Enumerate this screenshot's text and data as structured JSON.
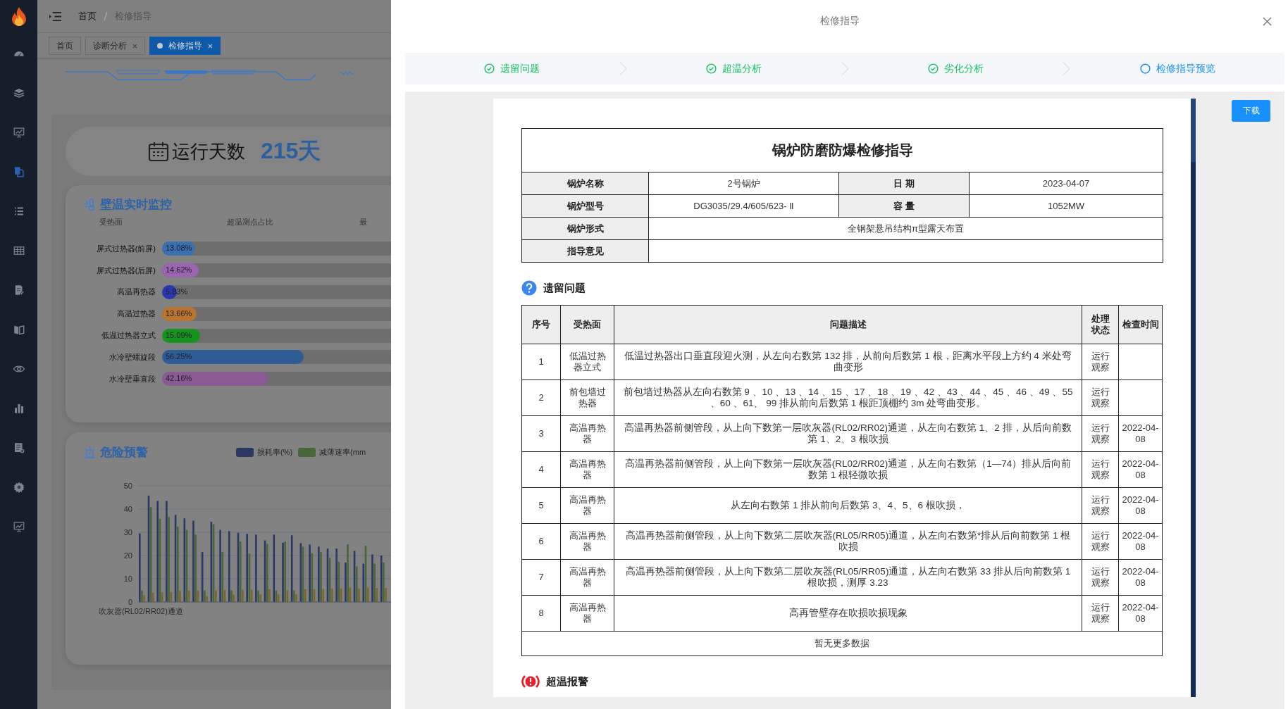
{
  "sidebar": {
    "items": [
      {
        "selected": false
      },
      {
        "selected": false
      },
      {
        "selected": false
      },
      {
        "selected": true
      },
      {
        "selected": false
      },
      {
        "selected": false
      },
      {
        "selected": false
      },
      {
        "selected": false
      },
      {
        "selected": false
      },
      {
        "selected": false
      },
      {
        "selected": false
      },
      {
        "selected": false
      },
      {
        "selected": false
      }
    ]
  },
  "breadcrumb": [
    "首页",
    "检修指导"
  ],
  "tags": [
    {
      "label": "首页",
      "selected": false,
      "closable": false
    },
    {
      "label": "诊断分析",
      "selected": false,
      "closable": true
    },
    {
      "label": "检修指导",
      "selected": true,
      "closable": true
    }
  ],
  "run_days": {
    "label": "运行天数",
    "value": "215天"
  },
  "wall_temp": {
    "title": "壁温实时监控",
    "columns": [
      "受热面",
      "超温测点占比",
      "最"
    ],
    "rows": [
      {
        "name": "屏式过热器(前屏)",
        "level": 0.1308,
        "reading": "13.08%",
        "color": "#3a6fb0"
      },
      {
        "name": "屏式过热器(后屏)",
        "level": 0.1462,
        "reading": "14.62%",
        "color": "#9a64ae"
      },
      {
        "name": "高温再热器",
        "level": 0.0583,
        "reading": "5.83%",
        "color": "#2a38b0"
      },
      {
        "name": "高温过热器",
        "level": 0.1366,
        "reading": "13.66%",
        "color": "#b97530"
      },
      {
        "name": "低温过热器立式",
        "level": 0.1509,
        "reading": "15.09%",
        "color": "#16951e"
      },
      {
        "name": "水冷壁螺旋段",
        "level": 0.5625,
        "reading": "56.25%",
        "color": "#2e5d95"
      },
      {
        "name": "水冷壁垂直段",
        "level": 0.4216,
        "reading": "42.16%",
        "color": "#8a5a92"
      }
    ]
  },
  "danger": {
    "title": "危险预警",
    "chart_data": {
      "type": "bar",
      "grid": true,
      "ylim": [
        0,
        50
      ],
      "yticks": [
        0,
        10,
        20,
        30,
        40,
        50
      ],
      "categories": [
        "吹灰器(RL02/RR02)通道",
        null,
        null,
        null,
        null,
        null,
        null,
        null,
        null,
        null,
        null,
        null,
        null,
        null,
        null,
        null,
        null,
        null,
        null,
        null,
        null,
        null,
        null,
        null,
        null,
        null,
        null,
        null
      ],
      "series": [
        {
          "name": "损耗率(%)",
          "color": "#2a3863",
          "values": [
            29.5,
            45.8,
            43.5,
            43.5,
            37.5,
            36,
            35,
            21.5,
            34.5,
            31,
            30.5,
            29.8,
            29.3,
            29,
            26.5,
            29,
            25.5,
            28.7,
            25.3,
            24.7,
            23.8,
            23,
            23,
            17,
            22,
            16.5,
            20.5,
            20
          ]
        },
        {
          "name": "减薄速率(mm",
          "color": "#48663a",
          "values": [
            5,
            40.8,
            35.8,
            36.7,
            32.5,
            31,
            29,
            5,
            33.5,
            21.5,
            5,
            26,
            20.8,
            5,
            25,
            5,
            26,
            5,
            23.8,
            21,
            21.5,
            19,
            17.3,
            24.8,
            15.3,
            24.2,
            16.5,
            17
          ]
        },
        {
          "color": "#7d642c",
          "values": [
            3,
            4,
            4.2,
            4.3,
            4.8,
            4.9,
            5,
            2.5,
            5,
            5.2,
            3.2,
            5.3,
            5.3,
            3.2,
            5.5,
            3.2,
            5,
            3.2,
            5.5,
            5.5,
            5.6,
            5.8,
            5.8,
            6.2,
            5.8,
            6.2,
            6,
            6
          ]
        }
      ]
    }
  },
  "drawer": {
    "title": "检修指导",
    "steps": [
      {
        "label": "遗留问题",
        "completed": true
      },
      {
        "label": "超温分析",
        "completed": true
      },
      {
        "label": "劣化分析",
        "completed": true
      },
      {
        "label": "检修指导预览",
        "completed": false
      }
    ],
    "download": "下载",
    "document": {
      "title": "锅炉防磨防爆检修指导",
      "info_rows": [
        [
          {
            "label": "锅炉名称",
            "value": "2号锅炉"
          },
          {
            "label": "日 期",
            "value": "2023-04-07"
          }
        ],
        [
          {
            "label": "锅炉型号",
            "value": "DG3035/29.4/605/623- Ⅱ"
          },
          {
            "label": "容 量",
            "value": "1052MW"
          }
        ],
        [
          {
            "label": "锅炉形式",
            "value": "全钢架悬吊结构π型露天布置"
          }
        ],
        [
          {
            "label": "指导意见"
          }
        ]
      ],
      "sections": [
        {
          "kind": "question",
          "title": "遗留问题",
          "table": {
            "columns": [
              "序号",
              "受热面",
              "问题描述",
              "处理状态",
              "检查时间"
            ],
            "rows": [
              {
                "no": "1",
                "surface": "低温过热器立式",
                "description": "低温过热器出口垂直段迎火测，从左向右数第 132 排，从前向后数第 1 根，距离水平段上方约 4 米处弯曲变形",
                "status": "运行观察"
              },
              {
                "no": "2",
                "surface": "前包墙过热器",
                "description": "前包墙过热器从左向右数第 9 、10 、13 、14 、15 、17 、18 、19 、42 、43 、44 、45 、46 、49 、55 、60 、61、 99 排从前向后数第 1 根距顶棚约 3m 处弯曲变形。",
                "status": "运行观察"
              },
              {
                "no": "3",
                "surface": "高温再热器",
                "description": "高温再热器前侧管段，从上向下数第一层吹灰器(RL02/RR02)通道，从左向右数第 1、2 排，从后向前数第 1、2、3 根吹损",
                "status": "运行观察",
                "time": "2022-04-08"
              },
              {
                "no": "4",
                "surface": "高温再热器",
                "description": "高温再热器前侧管段，从上向下数第一层吹灰器(RL02/RR02)通道，从左向右数第（1—74）排从后向前数第 1 根轻微吹损",
                "status": "运行观察",
                "time": "2022-04-08"
              },
              {
                "no": "5",
                "surface": "高温再热器",
                "description": "从左向右数第 1 排从前向后数第 3、4、5、6 根吹损，",
                "status": "运行观察",
                "time": "2022-04-08"
              },
              {
                "no": "6",
                "surface": "高温再热器",
                "description": "高温再热器前侧管段，从上向下数第二层吹灰器(RL05/RR05)通道，从左向右数第*排从后向前数第 1 根吹损",
                "status": "运行观察",
                "time": "2022-04-08"
              },
              {
                "no": "7",
                "surface": "高温再热器",
                "description": "高温再热器前侧管段，从上向下数第二层吹灰器(RL05/RR05)通道，从左向右数第 33 排从后向前数第 1 根吹损，测厚 3.23",
                "status": "运行观察",
                "time": "2022-04-08"
              },
              {
                "no": "8",
                "surface": "高温再热器",
                "description": "高再管壁存在吹损吹损现象",
                "status": "运行观察",
                "time": "2022-04-08"
              }
            ],
            "footer": "暂无更多数据"
          }
        },
        {
          "kind": "alarm",
          "title": "超温报警"
        }
      ]
    }
  }
}
